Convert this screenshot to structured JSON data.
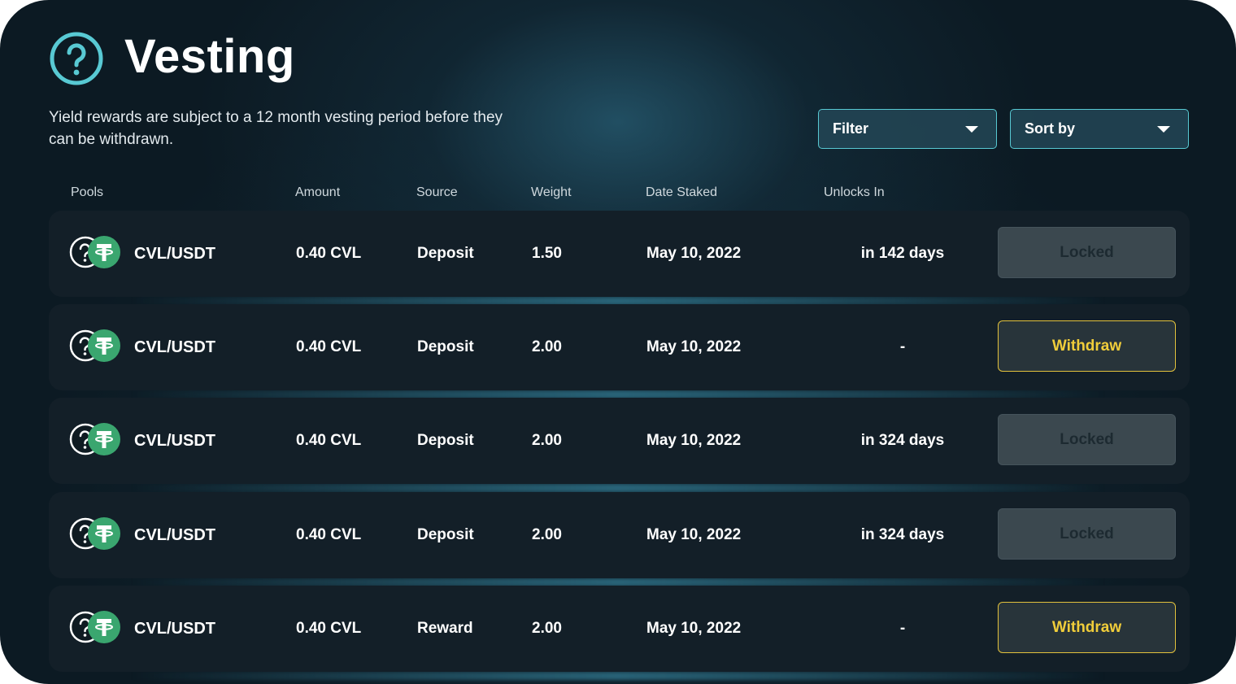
{
  "header": {
    "title": "Vesting",
    "icon": "question-circle-icon",
    "subtitle": "Yield rewards are subject to a 12 month vesting period before they can be withdrawn."
  },
  "controls": {
    "filter_label": "Filter",
    "sort_label": "Sort by"
  },
  "columns": {
    "pools": "Pools",
    "amount": "Amount",
    "source": "Source",
    "weight": "Weight",
    "date_staked": "Date Staked",
    "unlocks_in": "Unlocks In"
  },
  "rows": [
    {
      "pool": "CVL/USDT",
      "amount": "0.40 CVL",
      "source": "Deposit",
      "weight": "1.50",
      "date": "May 10, 2022",
      "unlocks": "in 142 days",
      "action": "Locked",
      "action_state": "locked"
    },
    {
      "pool": "CVL/USDT",
      "amount": "0.40 CVL",
      "source": "Deposit",
      "weight": "2.00",
      "date": "May 10, 2022",
      "unlocks": "-",
      "action": "Withdraw",
      "action_state": "withdraw"
    },
    {
      "pool": "CVL/USDT",
      "amount": "0.40 CVL",
      "source": "Deposit",
      "weight": "2.00",
      "date": "May 10, 2022",
      "unlocks": "in 324 days",
      "action": "Locked",
      "action_state": "locked"
    },
    {
      "pool": "CVL/USDT",
      "amount": "0.40 CVL",
      "source": "Deposit",
      "weight": "2.00",
      "date": "May 10, 2022",
      "unlocks": "in 324 days",
      "action": "Locked",
      "action_state": "locked"
    },
    {
      "pool": "CVL/USDT",
      "amount": "0.40 CVL",
      "source": "Reward",
      "weight": "2.00",
      "date": "May 10, 2022",
      "unlocks": "-",
      "action": "Withdraw",
      "action_state": "withdraw"
    }
  ],
  "colors": {
    "accent": "#58c9d3",
    "withdraw": "#e2c13c",
    "usdt_green": "#3aa66f",
    "background": "#0c1a23"
  }
}
